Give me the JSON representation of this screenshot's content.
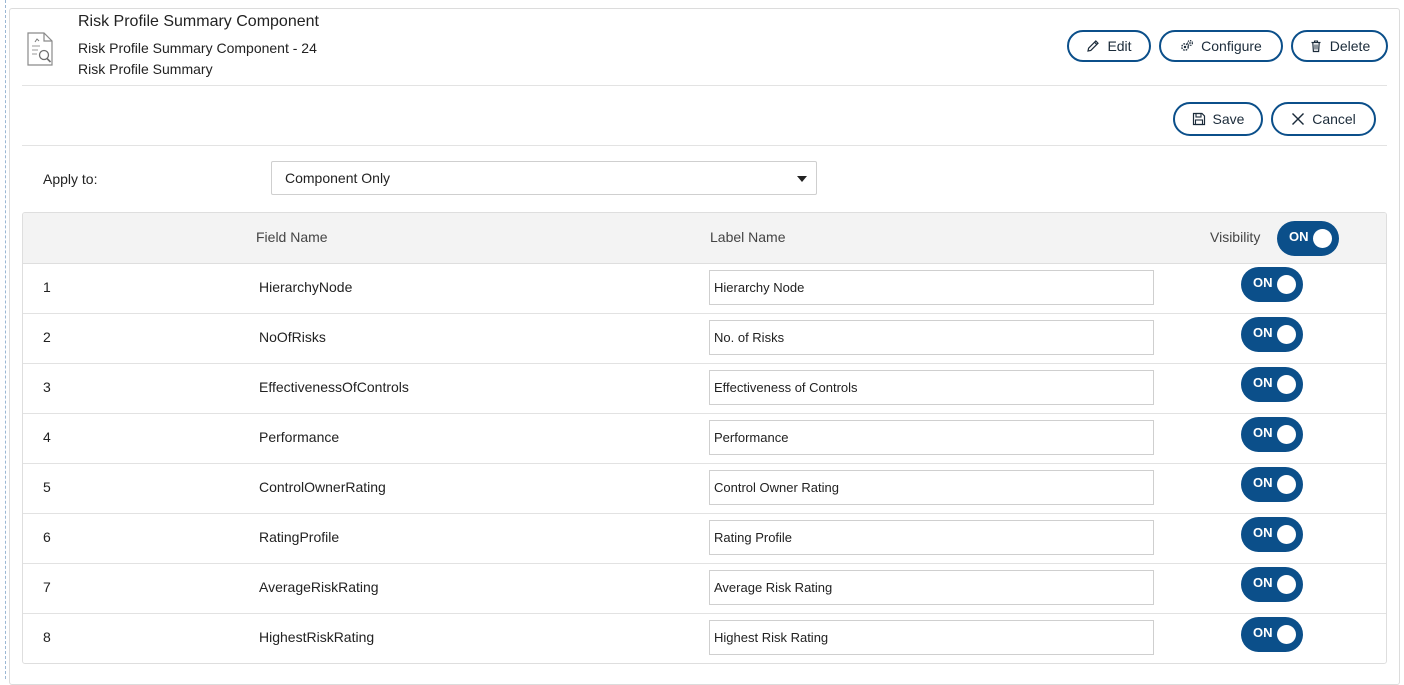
{
  "component": {
    "title": "Risk Profile Summary Component",
    "subtitle": "Risk Profile Summary Component - 24",
    "type": "Risk Profile Summary",
    "icon": "report-chart-icon"
  },
  "actions": {
    "edit_label": "Edit",
    "configure_label": "Configure",
    "delete_label": "Delete",
    "save_label": "Save",
    "cancel_label": "Cancel"
  },
  "apply_to": {
    "label": "Apply to:",
    "selected": "Component Only"
  },
  "table": {
    "headers": {
      "field": "Field Name",
      "label": "Label Name",
      "visibility": "Visibility",
      "visibility_all": "ON"
    },
    "rows": [
      {
        "num": "1",
        "field": "HierarchyNode",
        "label": "Hierarchy Node",
        "visibility": "ON"
      },
      {
        "num": "2",
        "field": "NoOfRisks",
        "label": "No. of Risks",
        "visibility": "ON"
      },
      {
        "num": "3",
        "field": "EffectivenessOfControls",
        "label": "Effectiveness of Controls",
        "visibility": "ON"
      },
      {
        "num": "4",
        "field": "Performance",
        "label": "Performance",
        "visibility": "ON"
      },
      {
        "num": "5",
        "field": "ControlOwnerRating",
        "label": "Control Owner Rating",
        "visibility": "ON"
      },
      {
        "num": "6",
        "field": "RatingProfile",
        "label": "Rating Profile",
        "visibility": "ON"
      },
      {
        "num": "7",
        "field": "AverageRiskRating",
        "label": "Average Risk Rating",
        "visibility": "ON"
      },
      {
        "num": "8",
        "field": "HighestRiskRating",
        "label": "Highest Risk Rating",
        "visibility": "ON"
      }
    ]
  },
  "colors": {
    "accent": "#0b4f8a",
    "border": "#dcdcdc",
    "header_bg": "#f3f3f3"
  }
}
